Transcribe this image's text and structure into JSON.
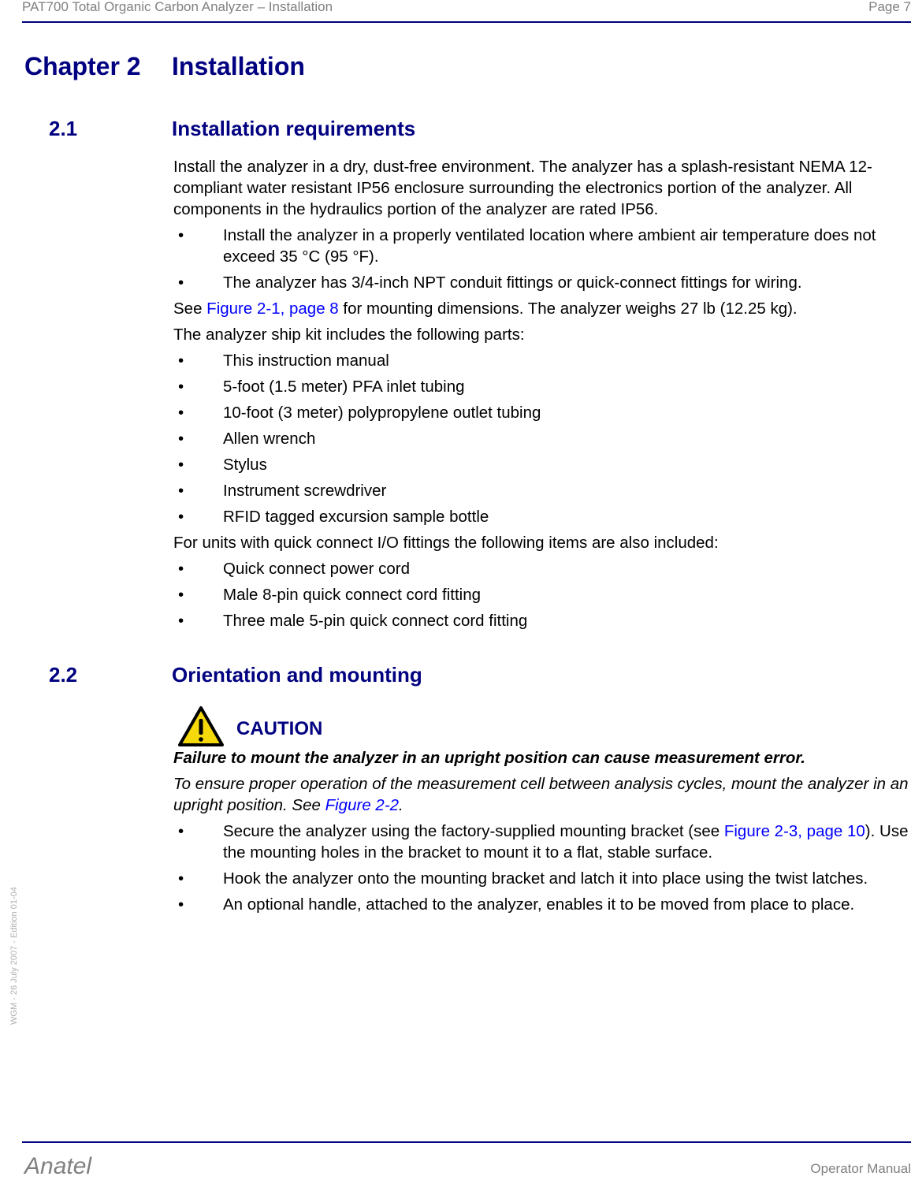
{
  "header": {
    "title": "PAT700 Total Organic Carbon Analyzer – Installation",
    "page": "Page 7"
  },
  "chapter": {
    "number": "Chapter 2",
    "title": "Installation"
  },
  "section_2_1": {
    "number": "2.1",
    "title": "Installation requirements",
    "intro": "Install the analyzer in a dry, dust-free environment. The analyzer has a splash-resistant NEMA 12-compliant water resistant IP56 enclosure surrounding the electronics portion of the analyzer. All components in the hydraulics portion of the analyzer are rated IP56.",
    "requirements": [
      "Install the analyzer in a properly ventilated location where ambient air temperature does not exceed 35 °C (95 °F).",
      "The analyzer has 3/4-inch NPT conduit fittings or quick-connect fittings for wiring."
    ],
    "see_prefix": "See ",
    "see_link": "Figure 2-1, page 8",
    "see_suffix": " for mounting dimensions. The analyzer weighs 27 lb (12.25 kg).",
    "kit_intro": "The analyzer ship kit includes the following parts:",
    "kit_items": [
      "This instruction manual",
      "5-foot (1.5 meter) PFA inlet tubing",
      "10-foot (3 meter) polypropylene outlet tubing",
      "Allen wrench",
      "Stylus",
      "Instrument screwdriver",
      "RFID tagged excursion sample bottle"
    ],
    "quick_intro": "For units with quick connect I/O fittings the following items are also included:",
    "quick_items": [
      "Quick connect power cord",
      "Male 8-pin quick connect cord fitting",
      "Three male 5-pin quick connect cord fitting"
    ]
  },
  "section_2_2": {
    "number": "2.2",
    "title": "Orientation and mounting",
    "caution_label": "CAUTION",
    "caution_icon": "warning-triangle-icon",
    "caution_bold": "Failure to mount the analyzer in an upright position can cause measurement error.",
    "caution_text_prefix": "To ensure proper operation of the measurement cell between analysis cycles, mount the analyzer in an upright position. See ",
    "caution_link": "Figure 2-2",
    "caution_text_suffix": ".",
    "bullet1_prefix": "Secure the analyzer using the factory-supplied mounting bracket (see ",
    "bullet1_link": "Figure 2-3, page 10",
    "bullet1_suffix": "). Use the mounting holes in the bracket to mount it to a flat, stable surface.",
    "bullet2": "Hook the analyzer onto the mounting bracket and latch it into place using the twist latches.",
    "bullet3": "An optional handle, attached to the analyzer, enables it to be moved from place to place."
  },
  "side_note": "WGM - 26 July 2007 - Edition 01-04",
  "footer": {
    "brand": "Anatel",
    "doc": "Operator Manual"
  },
  "bullet_char": "•",
  "colors": {
    "heading": "#000080",
    "link": "#0000ff",
    "header_text": "#808080"
  }
}
